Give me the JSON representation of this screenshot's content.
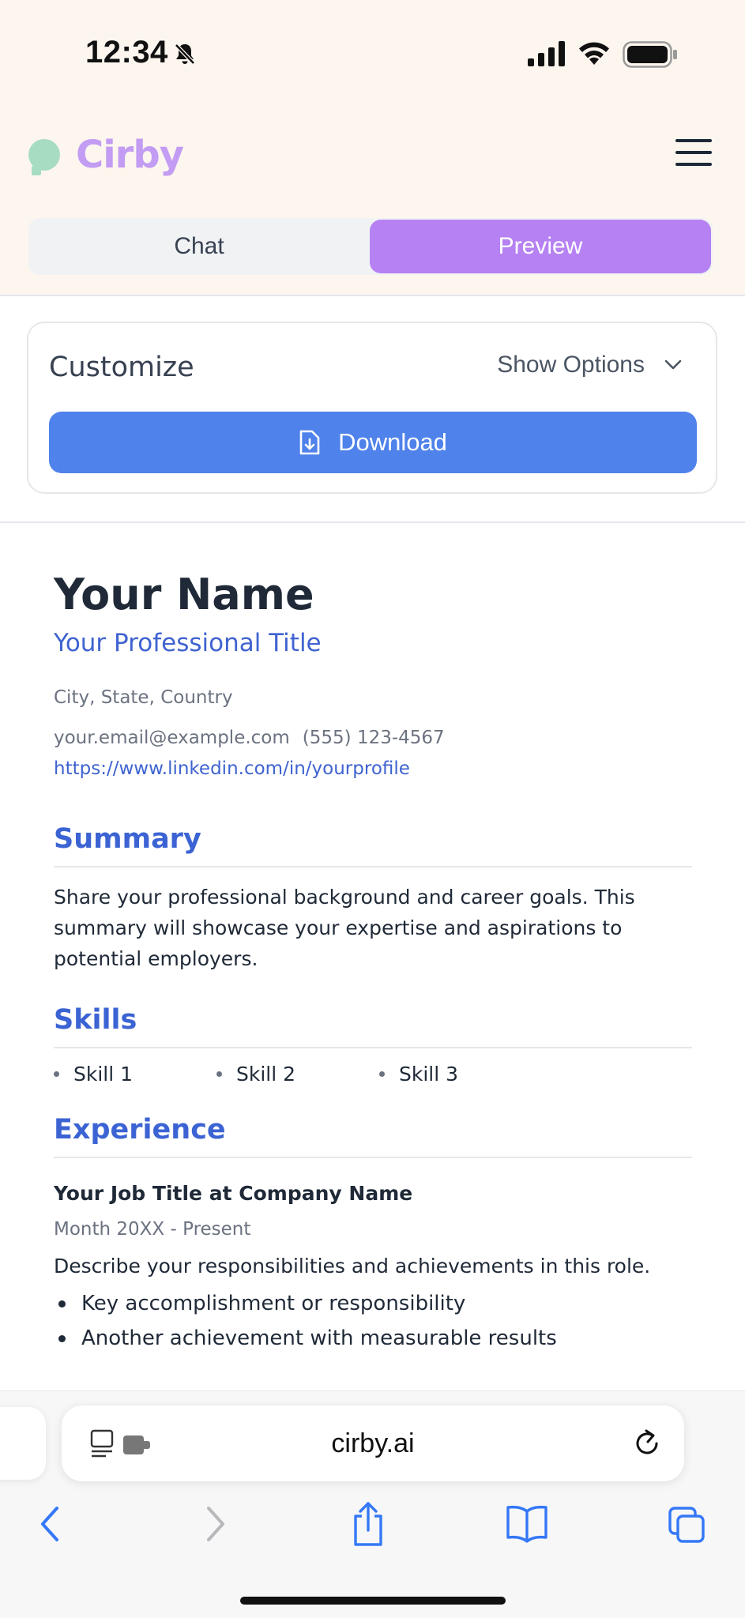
{
  "status_bar": {
    "time": "12:34"
  },
  "app": {
    "brand": "Cirby"
  },
  "tabs": [
    {
      "label": "Chat",
      "active": false
    },
    {
      "label": "Preview",
      "active": true
    }
  ],
  "customize": {
    "title": "Customize",
    "show_options": "Show Options",
    "download": "Download"
  },
  "resume": {
    "name": "Your Name",
    "title": "Your Professional Title",
    "location": "City, State, Country",
    "email": "your.email@example.com",
    "phone": "(555) 123-4567",
    "linkedin": "https://www.linkedin.com/in/yourprofile",
    "summary_heading": "Summary",
    "summary": "Share your professional background and career goals. This summary will showcase your expertise and aspirations to potential employers.",
    "skills_heading": "Skills",
    "skills": [
      "Skill 1",
      "Skill 2",
      "Skill 3"
    ],
    "experience_heading": "Experience",
    "job_title": "Your Job Title",
    "job_at": "at",
    "company": "Company Name",
    "dates": "Month 20XX - Present",
    "description": "Describe your responsibilities and achievements in this role.",
    "bullets": [
      "Key accomplishment or responsibility",
      "Another achievement with measurable results"
    ]
  },
  "browser": {
    "url": "cirby.ai"
  },
  "colors": {
    "accent_purple": "#b681f2",
    "brand": "#c39cf3",
    "primary_blue": "#4f82ea",
    "heading_blue": "#3b63d3"
  }
}
